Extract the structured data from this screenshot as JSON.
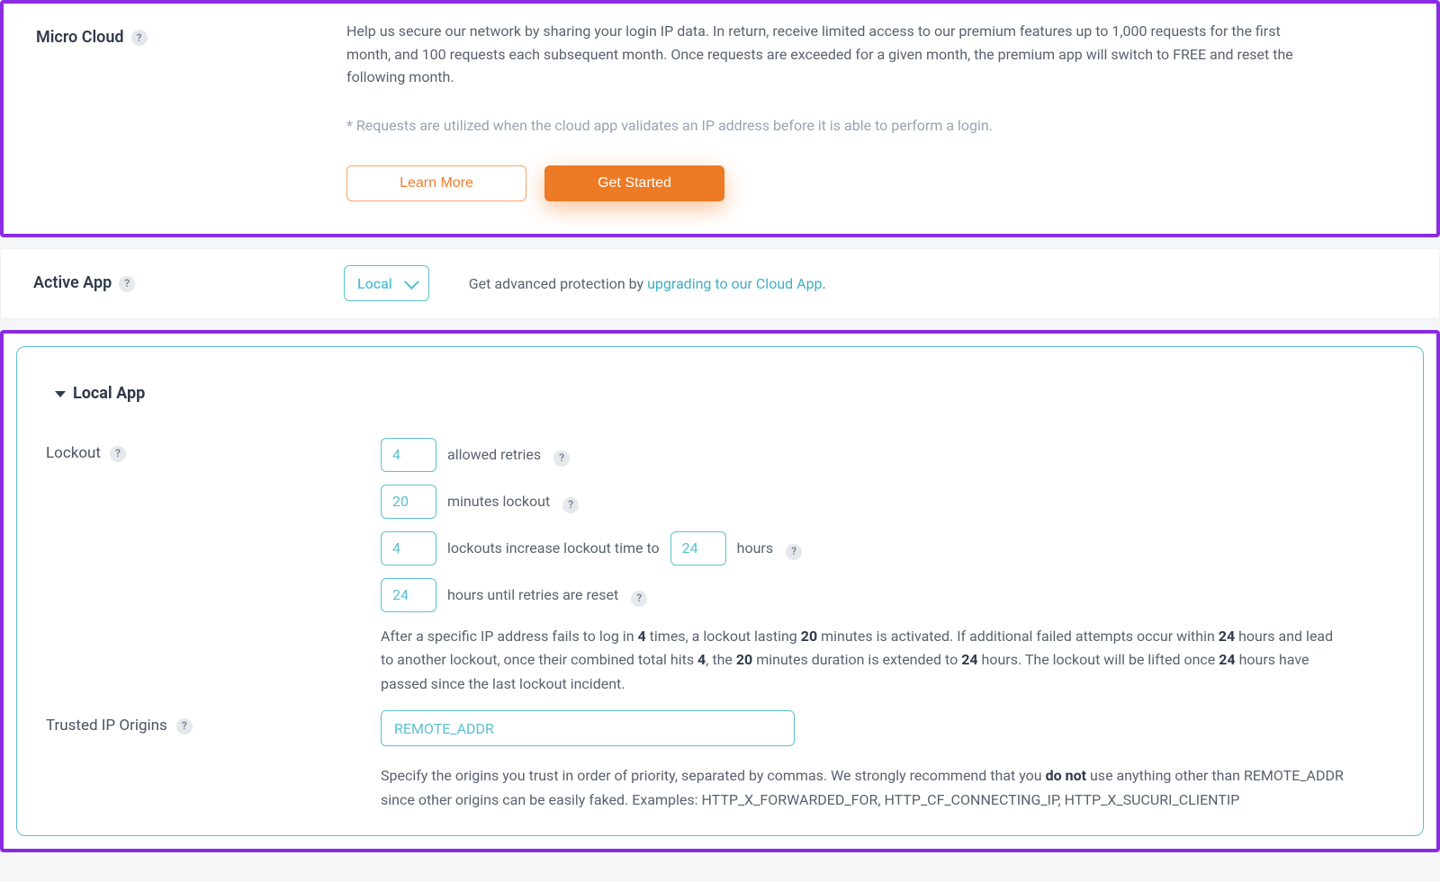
{
  "microCloud": {
    "title": "Micro Cloud",
    "desc": "Help us secure our network by sharing your login IP data. In return, receive limited access to our premium features up to 1,000 requests for the first month, and 100 requests each subsequent month. Once requests are exceeded for a given month, the premium app will switch to FREE and reset the following month.",
    "note": "* Requests are utilized when the cloud app validates an IP address before it is able to perform a login.",
    "learnMore": "Learn More",
    "getStarted": "Get Started"
  },
  "activeApp": {
    "title": "Active App",
    "selected": "Local",
    "hint_before": "Get advanced protection by ",
    "hint_link": "upgrading to our Cloud App",
    "hint_after": "."
  },
  "localApp": {
    "header": "Local App",
    "lockout": {
      "label": "Lockout",
      "retries": "4",
      "retries_label": "allowed retries",
      "lockout_minutes": "20",
      "lockout_minutes_label": "minutes lockout",
      "lockouts_count": "4",
      "lockouts_increase_label_a": "lockouts increase lockout time to",
      "lockout_hours": "24",
      "lockouts_increase_label_b": "hours",
      "reset_hours": "24",
      "reset_label": "hours until retries are reset",
      "explain_1a": "After a specific IP address fails to log in ",
      "explain_1b": " times, a lockout lasting ",
      "explain_1c": " minutes is activated. If additional failed attempts occur within ",
      "explain_1d": " hours and lead to another lockout, once their combined total hits ",
      "explain_1e": ", the ",
      "explain_1f": " minutes duration is extended to ",
      "explain_1g": " hours. The lockout will be lifted once ",
      "explain_1h": " hours have passed since the last lockout incident.",
      "v_retries": "4",
      "v_mins": "20",
      "v_within": "24",
      "v_total": "4",
      "v_mins2": "20",
      "v_ext": "24",
      "v_lift": "24"
    },
    "trusted": {
      "label": "Trusted IP Origins",
      "value": "REMOTE_ADDR",
      "desc_a": "Specify the origins you trust in order of priority, separated by commas. We strongly recommend that you ",
      "desc_bold": "do not",
      "desc_b": " use anything other than REMOTE_ADDR since other origins can be easily faked. Examples: HTTP_X_FORWARDED_FOR, HTTP_CF_CONNECTING_IP, HTTP_X_SUCURI_CLIENTIP"
    }
  },
  "help": "?"
}
